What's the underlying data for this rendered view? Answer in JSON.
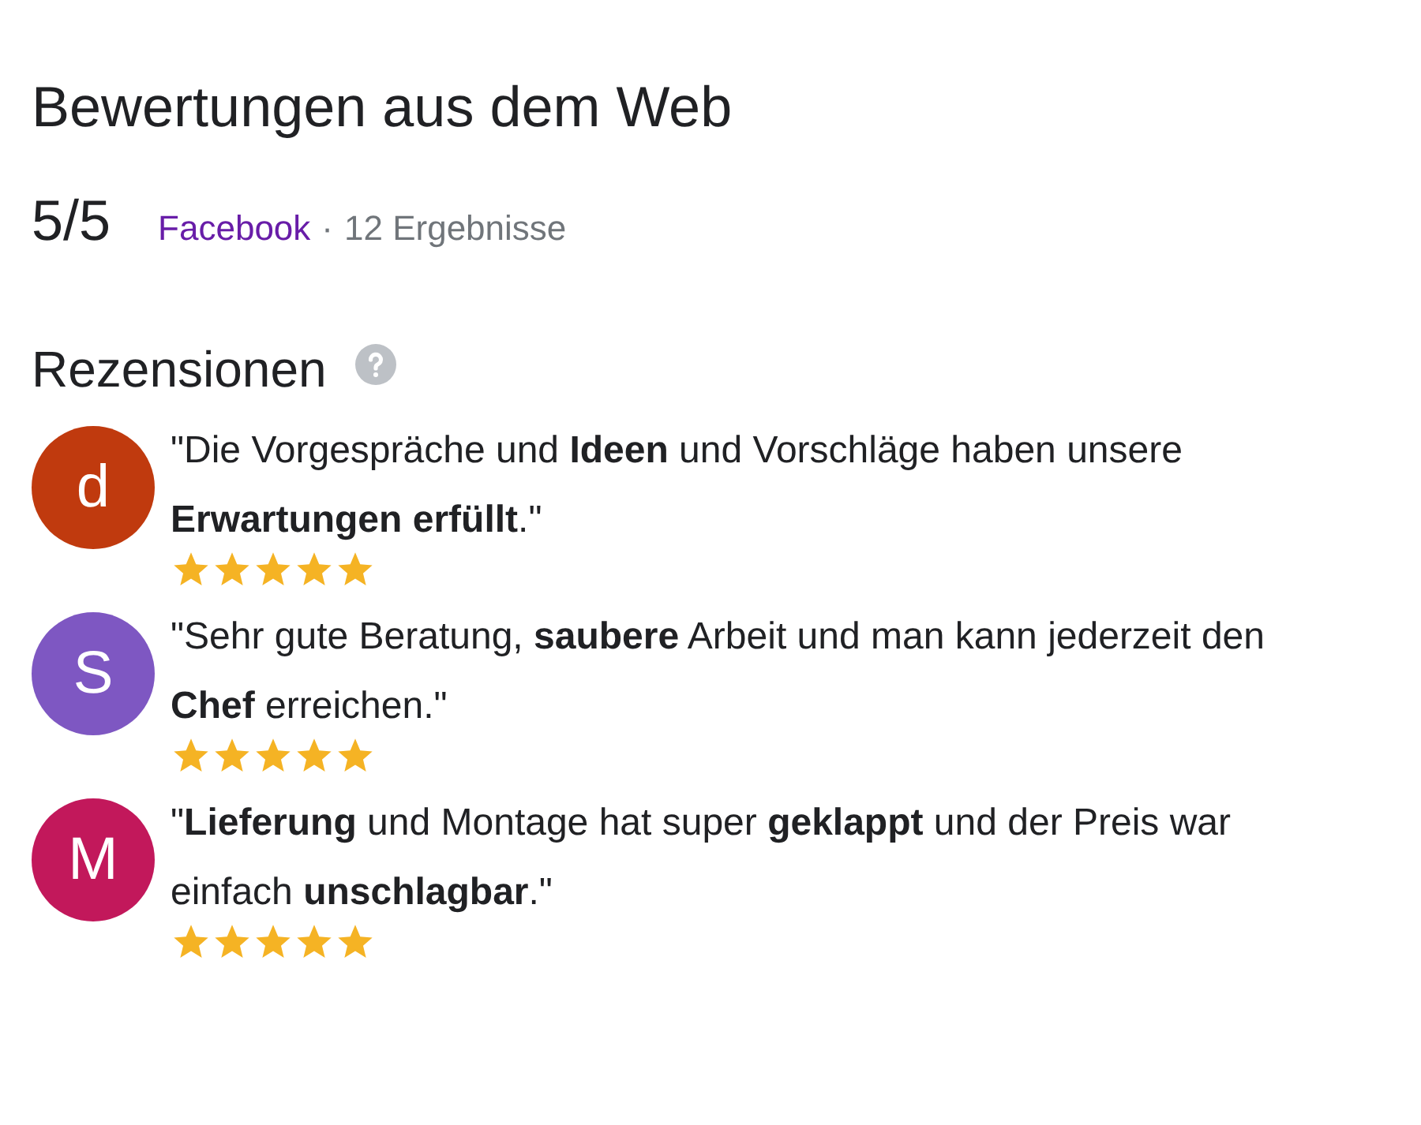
{
  "title": "Bewertungen aus dem Web",
  "summary": {
    "score": "5/5",
    "source": "Facebook",
    "separator": "·",
    "count": "12 Ergebnisse"
  },
  "reviews_section": {
    "title": "Rezensionen"
  },
  "reviews": [
    {
      "initial": "d",
      "color": "#c03a0e",
      "text": "\"Die Vorgespräche und **Ideen** und Vorschläge haben unsere **Erwartungen erfüllt**.\"",
      "stars": 5
    },
    {
      "initial": "S",
      "color": "#7e57c2",
      "text": "\"Sehr gute Beratung, **saubere** Arbeit und man kann jederzeit den **Chef** erreichen.\"",
      "stars": 5
    },
    {
      "initial": "M",
      "color": "#c2185b",
      "text": "\"**Lieferung** und Montage hat super **geklappt** und der Preis war einfach **unschlagbar**.\"",
      "stars": 5
    }
  ]
}
